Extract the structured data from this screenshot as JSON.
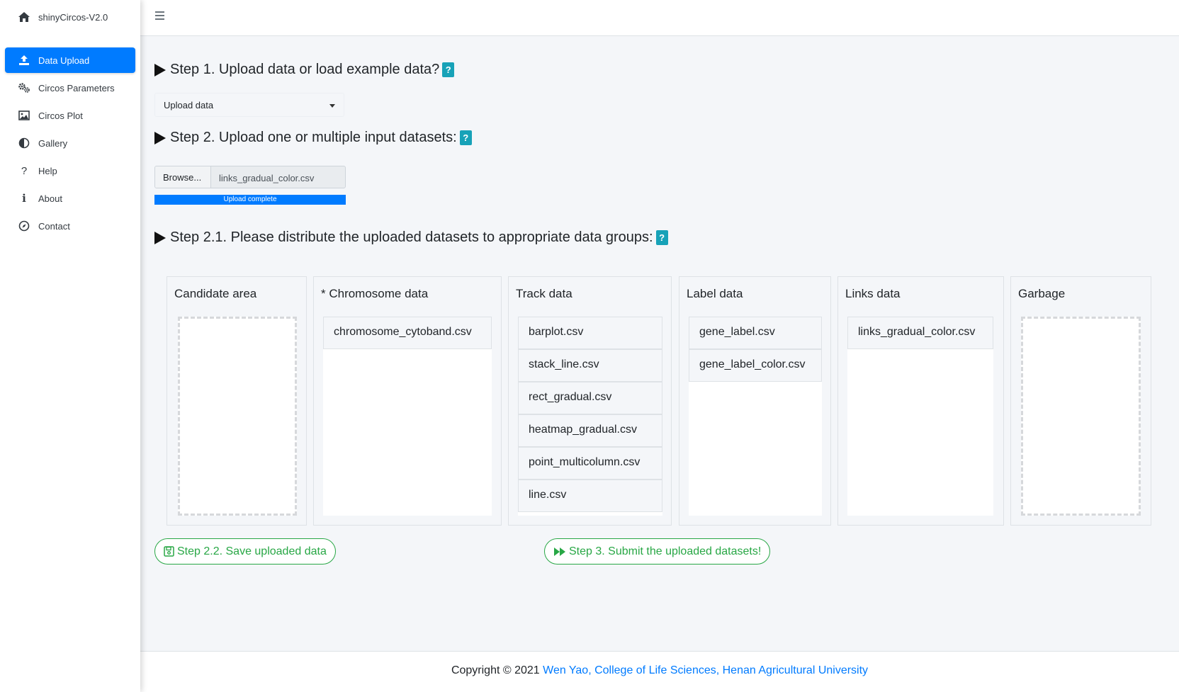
{
  "app": {
    "title": "shinyCircos-V2.0"
  },
  "sidebar": {
    "items": [
      {
        "label": "Data Upload",
        "icon": "upload-icon",
        "active": true
      },
      {
        "label": "Circos Parameters",
        "icon": "gears-icon"
      },
      {
        "label": "Circos Plot",
        "icon": "image-icon"
      },
      {
        "label": "Gallery",
        "icon": "half-circle-icon"
      },
      {
        "label": "Help",
        "icon": "question-icon"
      },
      {
        "label": "About",
        "icon": "info-icon"
      },
      {
        "label": "Contact",
        "icon": "compass-icon"
      }
    ]
  },
  "steps": {
    "step1": "Step 1. Upload data or load example data?",
    "step2": "Step 2. Upload one or multiple input datasets:",
    "step21": "Step 2.1. Please distribute the uploaded datasets to appropriate data groups:",
    "help_mark": "?"
  },
  "upload_select": {
    "value": "Upload data"
  },
  "file_input": {
    "browse_label": "Browse...",
    "filename": "links_gradual_color.csv",
    "progress_label": "Upload complete",
    "progress": 1.0
  },
  "groups": [
    {
      "title": "Candidate area",
      "items": []
    },
    {
      "title": "* Chromosome data",
      "items": [
        "chromosome_cytoband.csv"
      ]
    },
    {
      "title": "Track data",
      "items": [
        "barplot.csv",
        "stack_line.csv",
        "rect_gradual.csv",
        "heatmap_gradual.csv",
        "point_multicolumn.csv",
        "line.csv"
      ]
    },
    {
      "title": "Label data",
      "items": [
        "gene_label.csv",
        "gene_label_color.csv"
      ]
    },
    {
      "title": "Links data",
      "items": [
        "links_gradual_color.csv"
      ]
    },
    {
      "title": "Garbage",
      "items": []
    }
  ],
  "buttons": {
    "save": "Step 2.2. Save uploaded data",
    "submit": "Step 3. Submit the uploaded datasets!"
  },
  "footer": {
    "copyright": "Copyright © 2021 ",
    "link": "Wen Yao, College of Life Sciences, Henan Agricultural University"
  },
  "colors": {
    "primary": "#007bff",
    "success": "#28a745",
    "info": "#17a2b8",
    "background": "#f4f6f9"
  }
}
